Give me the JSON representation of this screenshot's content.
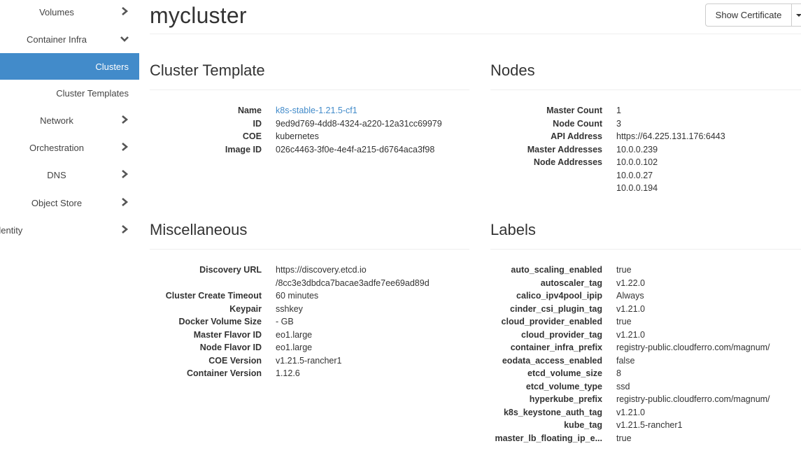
{
  "sidebar": {
    "items": [
      {
        "label": "Volumes",
        "icon": "chevron-right-icon",
        "state": "collapsed"
      },
      {
        "label": "Container Infra",
        "icon": "chevron-down-icon",
        "state": "expanded"
      },
      {
        "label": "Clusters",
        "state": "active",
        "sub": true
      },
      {
        "label": "Cluster Templates",
        "sub": true
      },
      {
        "label": "Network",
        "icon": "chevron-right-icon",
        "state": "collapsed"
      },
      {
        "label": "Orchestration",
        "icon": "chevron-right-icon",
        "state": "collapsed"
      },
      {
        "label": "DNS",
        "icon": "chevron-right-icon",
        "state": "collapsed"
      },
      {
        "label": "Object Store",
        "icon": "chevron-right-icon",
        "state": "collapsed"
      },
      {
        "label": "dentity",
        "icon": "chevron-right-icon",
        "state": "collapsed"
      }
    ],
    "active_color": "#428bca"
  },
  "header": {
    "title": "mycluster",
    "show_certificate_label": "Show Certificate"
  },
  "cluster_template": {
    "heading": "Cluster Template",
    "rows": [
      {
        "label": "Name",
        "value": "k8s-stable-1.21.5-cf1",
        "link": true
      },
      {
        "label": "ID",
        "value": "9ed9d769-4dd8-4324-a220-12a31cc69979"
      },
      {
        "label": "COE",
        "value": "kubernetes"
      },
      {
        "label": "Image ID",
        "value": "026c4463-3f0e-4e4f-a215-d6764aca3f98"
      }
    ]
  },
  "nodes": {
    "heading": "Nodes",
    "rows": [
      {
        "label": "Master Count",
        "value": "1"
      },
      {
        "label": "Node Count",
        "value": "3"
      },
      {
        "label": "API Address",
        "value": "https://64.225.131.176:6443"
      },
      {
        "label": "Master Addresses",
        "value": "10.0.0.239"
      },
      {
        "label": "Node Addresses",
        "value": "10.0.0.102"
      },
      {
        "label": "",
        "value": "10.0.0.27"
      },
      {
        "label": "",
        "value": "10.0.0.194"
      }
    ]
  },
  "miscellaneous": {
    "heading": "Miscellaneous",
    "rows": [
      {
        "label": "Discovery URL",
        "value": "https://discovery.etcd.io"
      },
      {
        "label": "",
        "value": "/8cc3e3dbdca7bacae3adfe7ee69ad89d"
      },
      {
        "label": "Cluster Create Timeout",
        "value": "60 minutes"
      },
      {
        "label": "Keypair",
        "value": "sshkey"
      },
      {
        "label": "Docker Volume Size",
        "value": "- GB"
      },
      {
        "label": "Master Flavor ID",
        "value": "eo1.large"
      },
      {
        "label": "Node Flavor ID",
        "value": "eo1.large"
      },
      {
        "label": "COE Version",
        "value": "v1.21.5-rancher1"
      },
      {
        "label": "Container Version",
        "value": "1.12.6"
      }
    ]
  },
  "labels": {
    "heading": "Labels",
    "rows": [
      {
        "label": "auto_scaling_enabled",
        "value": "true"
      },
      {
        "label": "autoscaler_tag",
        "value": "v1.22.0"
      },
      {
        "label": "calico_ipv4pool_ipip",
        "value": "Always"
      },
      {
        "label": "cinder_csi_plugin_tag",
        "value": "v1.21.0"
      },
      {
        "label": "cloud_provider_enabled",
        "value": "true"
      },
      {
        "label": "cloud_provider_tag",
        "value": "v1.21.0"
      },
      {
        "label": "container_infra_prefix",
        "value": "registry-public.cloudferro.com/magnum/"
      },
      {
        "label": "eodata_access_enabled",
        "value": "false"
      },
      {
        "label": "etcd_volume_size",
        "value": "8"
      },
      {
        "label": "etcd_volume_type",
        "value": "ssd"
      },
      {
        "label": "hyperkube_prefix",
        "value": "registry-public.cloudferro.com/magnum/"
      },
      {
        "label": "k8s_keystone_auth_tag",
        "value": "v1.21.0"
      },
      {
        "label": "kube_tag",
        "value": "v1.21.5-rancher1"
      },
      {
        "label": "master_lb_floating_ip_e...",
        "value": "true"
      }
    ]
  }
}
